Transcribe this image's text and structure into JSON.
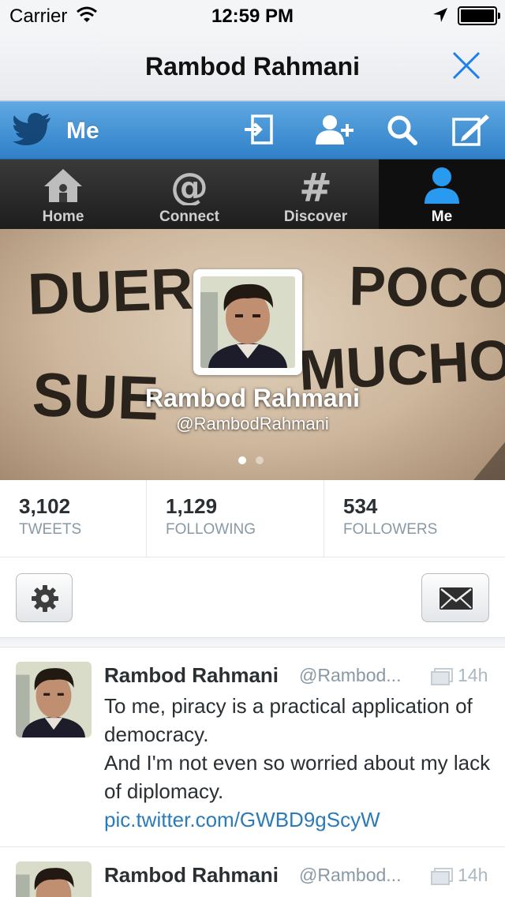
{
  "status_bar": {
    "carrier": "Carrier",
    "time": "12:59 PM"
  },
  "title_bar": {
    "title": "Rambod Rahmani"
  },
  "top_bar": {
    "label": "Me"
  },
  "tabs": [
    {
      "label": "Home"
    },
    {
      "label": "Connect"
    },
    {
      "label": "Discover"
    },
    {
      "label": "Me"
    }
  ],
  "profile": {
    "name": "Rambod Rahmani",
    "handle": "@RambodRahmani",
    "banner_text": [
      "DUER",
      "POCO",
      "SUE",
      "MUCHO"
    ],
    "page_dots": {
      "count": 2,
      "active": 1
    }
  },
  "stats": [
    {
      "value": "3,102",
      "label": "TWEETS"
    },
    {
      "value": "1,129",
      "label": "FOLLOWING"
    },
    {
      "value": "534",
      "label": "FOLLOWERS"
    }
  ],
  "tweets": [
    {
      "name": "Rambod Rahmani",
      "handle": "@Rambod...",
      "time": "14h",
      "lines": [
        "To me, piracy is a practical application of democracy.",
        "And I'm not even so worried about my lack of diplomacy."
      ],
      "link": "pic.twitter.com/GWBD9gScyW"
    },
    {
      "name": "Rambod Rahmani",
      "handle": "@Rambod...",
      "time": "14h"
    }
  ],
  "colors": {
    "twitter_blue": "#3f8fd2",
    "link": "#2b7bb9",
    "muted": "#8899a6"
  }
}
